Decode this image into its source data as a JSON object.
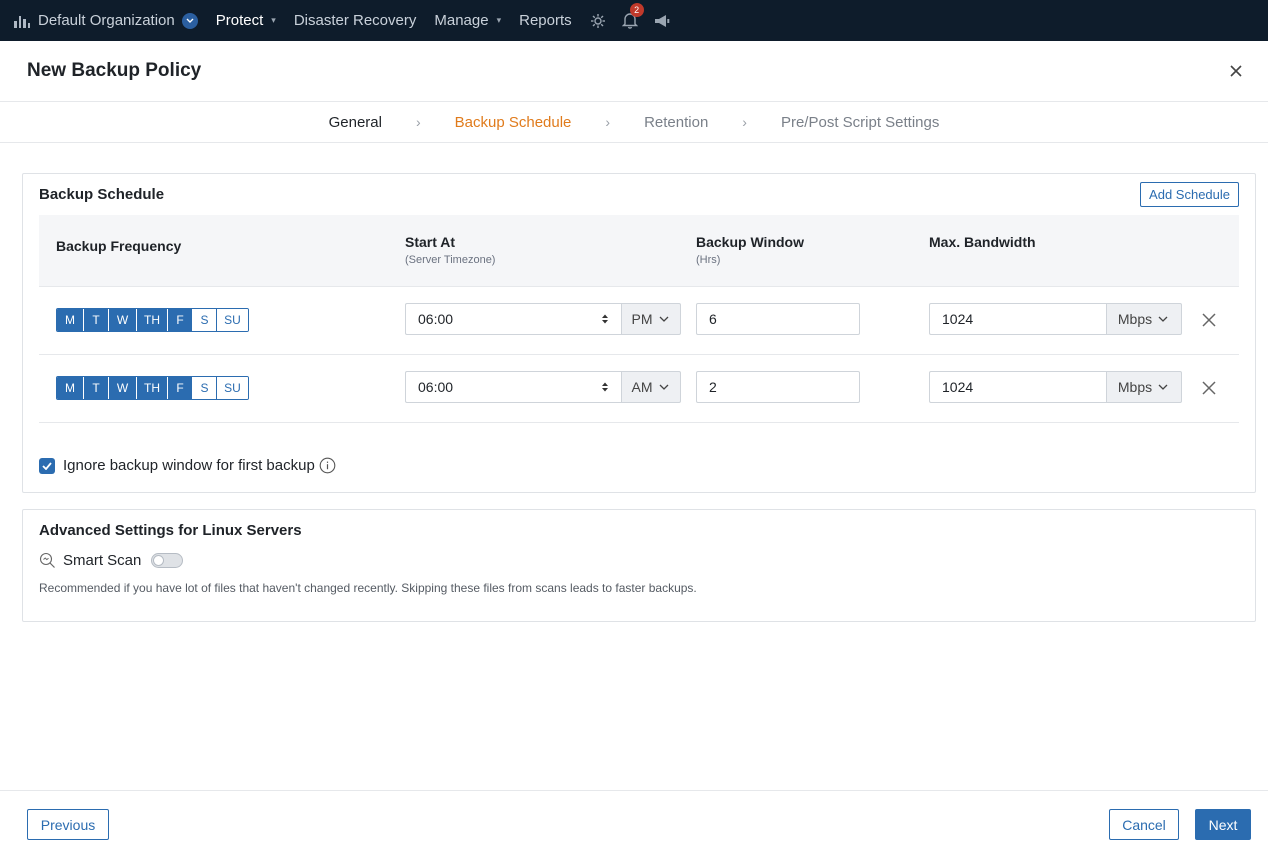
{
  "topnav": {
    "org": "Default Organization",
    "items": [
      "Protect",
      "Disaster Recovery",
      "Manage",
      "Reports"
    ],
    "notification_count": "2",
    "icons": [
      "bar-chart-icon",
      "gear-icon",
      "bell-icon",
      "megaphone-icon"
    ]
  },
  "modal": {
    "title": "New Backup Policy"
  },
  "stepper": {
    "steps": [
      "General",
      "Backup Schedule",
      "Retention",
      "Pre/Post Script Settings"
    ],
    "current": "Backup Schedule"
  },
  "schedule": {
    "title": "Backup Schedule",
    "add_label": "Add Schedule",
    "headers": {
      "frequency": "Backup Frequency",
      "start": "Start At",
      "start_sub": "(Server Timezone)",
      "window": "Backup Window",
      "window_sub": "(Hrs)",
      "bandwidth": "Max. Bandwidth"
    },
    "rows": [
      {
        "days": [
          {
            "label": "M",
            "on": true
          },
          {
            "label": "T",
            "on": true
          },
          {
            "label": "W",
            "on": true
          },
          {
            "label": "TH",
            "on": true
          },
          {
            "label": "F",
            "on": true
          },
          {
            "label": "S",
            "on": false
          },
          {
            "label": "SU",
            "on": false
          }
        ],
        "time": "06:00",
        "ampm": "PM",
        "window": "6",
        "bandwidth": "1024",
        "unit": "Mbps"
      },
      {
        "days": [
          {
            "label": "M",
            "on": true
          },
          {
            "label": "T",
            "on": true
          },
          {
            "label": "W",
            "on": true
          },
          {
            "label": "TH",
            "on": true
          },
          {
            "label": "F",
            "on": true
          },
          {
            "label": "S",
            "on": false
          },
          {
            "label": "SU",
            "on": false
          }
        ],
        "time": "06:00",
        "ampm": "AM",
        "window": "2",
        "bandwidth": "1024",
        "unit": "Mbps"
      }
    ],
    "ignore_label": "Ignore backup window for first backup",
    "ignore_checked": true
  },
  "advanced": {
    "title": "Advanced Settings for Linux Servers",
    "smart_scan_label": "Smart Scan",
    "smart_scan_on": false,
    "hint": "Recommended if you have lot of files that haven't changed recently. Skipping these files from scans leads to faster backups."
  },
  "footer": {
    "previous": "Previous",
    "cancel": "Cancel",
    "next": "Next"
  },
  "colors": {
    "nav_bg": "#0e1c2b",
    "accent": "#2b6cb0",
    "step_current": "#e07b1c"
  }
}
